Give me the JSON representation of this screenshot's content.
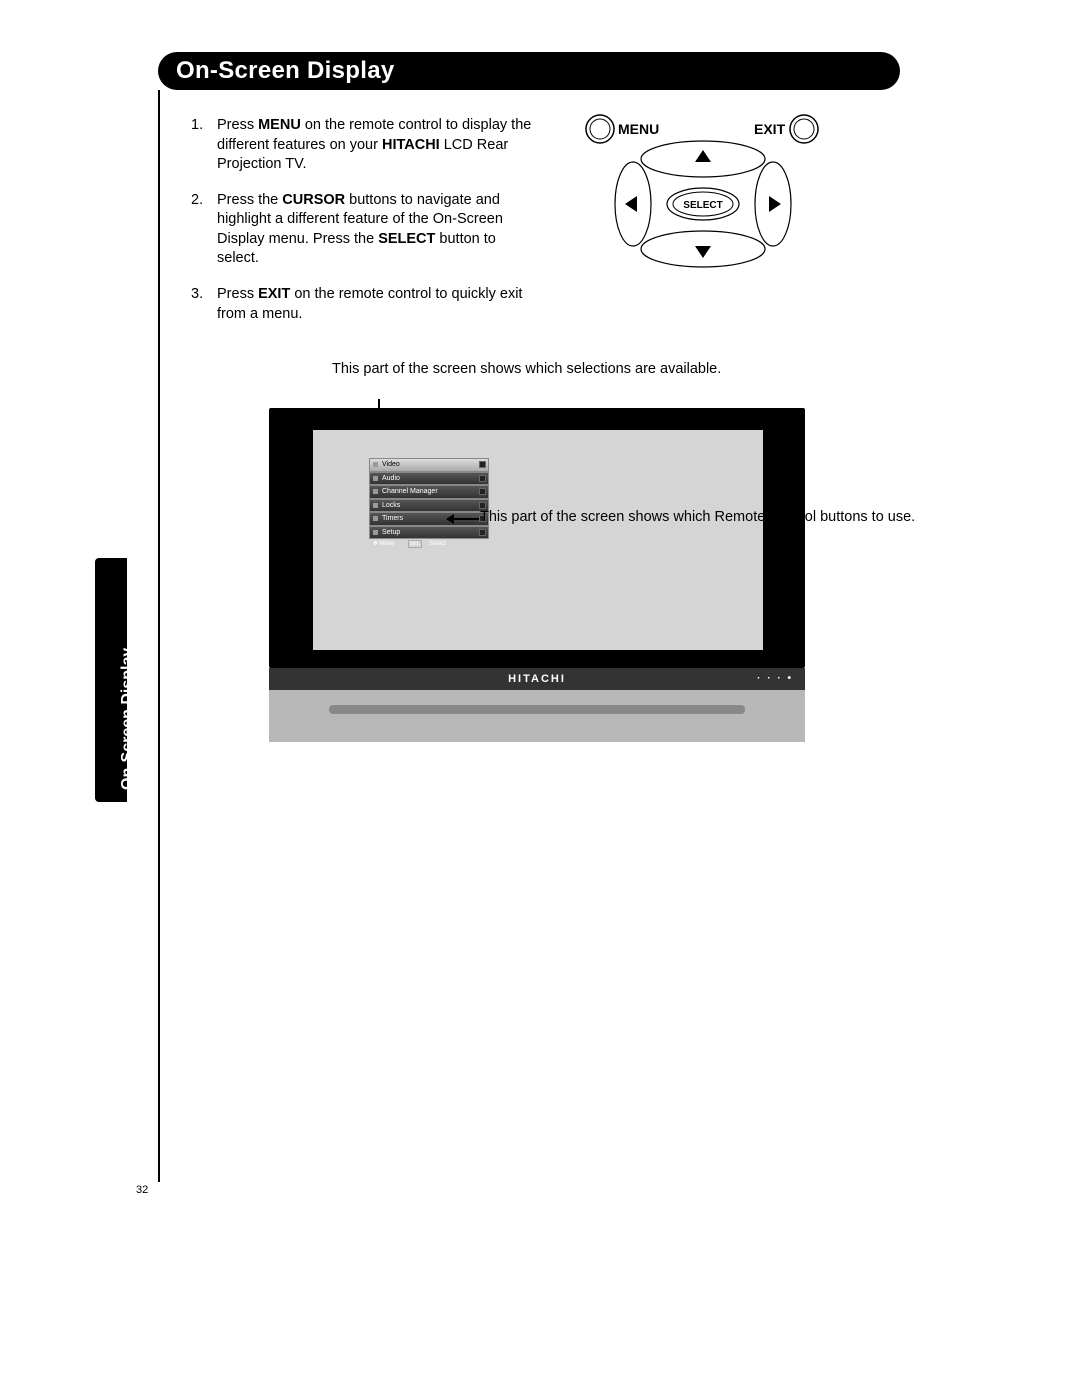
{
  "header": {
    "title": "On-Screen Display"
  },
  "instructions": [
    {
      "num": "1.",
      "html": "Press <b>MENU</b> on the remote control to display the different features on your <b>HITACHI</b> LCD Rear Projection TV."
    },
    {
      "num": "2.",
      "html": "Press the <b>CURSOR</b> buttons to navigate and highlight a different feature of the On-Screen Display menu. Press the <b>SELECT</b> button to select."
    },
    {
      "num": "3.",
      "html": "Press <b>EXIT</b> on the remote control to quickly exit from a menu."
    }
  ],
  "remote": {
    "menu_label": "MENU",
    "exit_label": "EXIT",
    "select_label": "SELECT"
  },
  "callouts": {
    "top": "This part of the screen shows which selections are available.",
    "right": "This part of the screen shows which Remote Control buttons to use."
  },
  "osd": {
    "items": [
      "Video",
      "Audio",
      "Channel Manager",
      "Locks",
      "Timers",
      "Setup"
    ],
    "hint_move": "Move",
    "hint_sel": "SEL",
    "hint_select": "Select"
  },
  "tv": {
    "brand": "HITACHI"
  },
  "side_tab": "On-Screen Display",
  "page_number": "32"
}
